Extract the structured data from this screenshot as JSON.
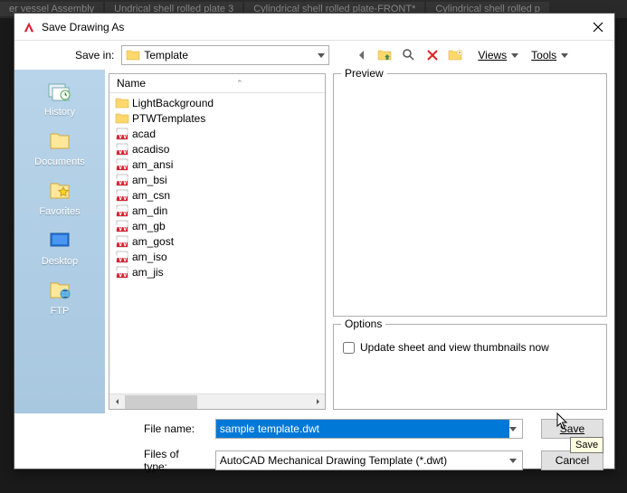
{
  "bg_tabs": [
    "er vessel Assembly",
    "Undrical shell rolled plate 3",
    "Cylindrical shell rolled plate-FRONT*",
    "Cylindrical shell rolled p"
  ],
  "dialog": {
    "title": "Save Drawing As",
    "save_in_label": "Save in:",
    "location": "Template",
    "views_label": "Views",
    "tools_label": "Tools"
  },
  "sidebar": {
    "items": [
      {
        "label": "History",
        "icon": "history-icon"
      },
      {
        "label": "Documents",
        "icon": "documents-icon"
      },
      {
        "label": "Favorites",
        "icon": "favorites-icon"
      },
      {
        "label": "Desktop",
        "icon": "desktop-icon"
      },
      {
        "label": "FTP",
        "icon": "ftp-icon"
      }
    ]
  },
  "file_list": {
    "header": "Name",
    "items": [
      {
        "name": "LightBackground",
        "type": "folder"
      },
      {
        "name": "PTWTemplates",
        "type": "folder"
      },
      {
        "name": "acad",
        "type": "dwt"
      },
      {
        "name": "acadiso",
        "type": "dwt"
      },
      {
        "name": "am_ansi",
        "type": "dwt"
      },
      {
        "name": "am_bsi",
        "type": "dwt"
      },
      {
        "name": "am_csn",
        "type": "dwt"
      },
      {
        "name": "am_din",
        "type": "dwt"
      },
      {
        "name": "am_gb",
        "type": "dwt"
      },
      {
        "name": "am_gost",
        "type": "dwt"
      },
      {
        "name": "am_iso",
        "type": "dwt"
      },
      {
        "name": "am_jis",
        "type": "dwt"
      }
    ]
  },
  "preview": {
    "legend": "Preview"
  },
  "options": {
    "legend": "Options",
    "checkbox_label": "Update sheet and view thumbnails now"
  },
  "form": {
    "filename_label": "File name:",
    "filename_value": "sample template.dwt",
    "filetype_label": "Files of type:",
    "filetype_value": "AutoCAD Mechanical Drawing Template (*.dwt)",
    "save_btn": "Save",
    "cancel_btn": "Cancel"
  },
  "tooltip": "Save"
}
